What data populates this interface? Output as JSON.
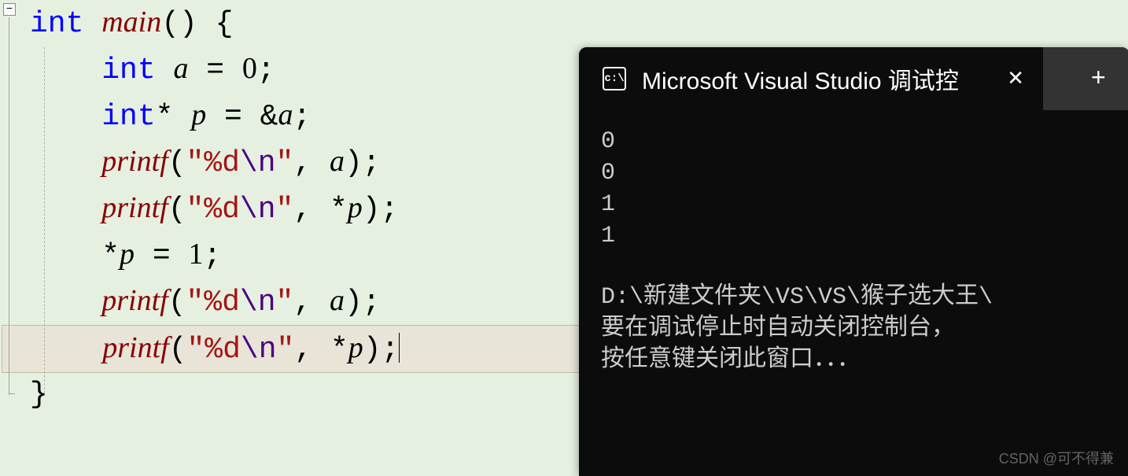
{
  "editor": {
    "fold_symbol": "−",
    "lines": [
      {
        "indent": 0,
        "tokens": [
          {
            "cls": "kw",
            "t": "int"
          },
          {
            "cls": "",
            "t": " "
          },
          {
            "cls": "fn ident",
            "t": "main"
          },
          {
            "cls": "op",
            "t": "() {"
          }
        ]
      },
      {
        "indent": 1,
        "tokens": [
          {
            "cls": "kw",
            "t": "int"
          },
          {
            "cls": "",
            "t": " "
          },
          {
            "cls": "ident",
            "t": "a"
          },
          {
            "cls": "op",
            "t": " = "
          },
          {
            "cls": "num",
            "t": "0"
          },
          {
            "cls": "op",
            "t": ";"
          }
        ]
      },
      {
        "indent": 1,
        "tokens": [
          {
            "cls": "kw",
            "t": "int"
          },
          {
            "cls": "op",
            "t": "* "
          },
          {
            "cls": "ident",
            "t": "p"
          },
          {
            "cls": "op",
            "t": " = &"
          },
          {
            "cls": "ident",
            "t": "a"
          },
          {
            "cls": "op",
            "t": ";"
          }
        ]
      },
      {
        "indent": 1,
        "tokens": [
          {
            "cls": "fn ident",
            "t": "printf"
          },
          {
            "cls": "op",
            "t": "("
          },
          {
            "cls": "str",
            "t": "\"%d"
          },
          {
            "cls": "esc",
            "t": "\\n"
          },
          {
            "cls": "str",
            "t": "\""
          },
          {
            "cls": "op",
            "t": ", "
          },
          {
            "cls": "ident",
            "t": "a"
          },
          {
            "cls": "op",
            "t": ");"
          }
        ]
      },
      {
        "indent": 1,
        "tokens": [
          {
            "cls": "fn ident",
            "t": "printf"
          },
          {
            "cls": "op",
            "t": "("
          },
          {
            "cls": "str",
            "t": "\"%d"
          },
          {
            "cls": "esc",
            "t": "\\n"
          },
          {
            "cls": "str",
            "t": "\""
          },
          {
            "cls": "op",
            "t": ", *"
          },
          {
            "cls": "ident",
            "t": "p"
          },
          {
            "cls": "op",
            "t": ");"
          }
        ]
      },
      {
        "indent": 1,
        "tokens": [
          {
            "cls": "op",
            "t": "*"
          },
          {
            "cls": "ident",
            "t": "p"
          },
          {
            "cls": "op",
            "t": " = "
          },
          {
            "cls": "num",
            "t": "1"
          },
          {
            "cls": "op",
            "t": ";"
          }
        ]
      },
      {
        "indent": 1,
        "tokens": [
          {
            "cls": "fn ident",
            "t": "printf"
          },
          {
            "cls": "op",
            "t": "("
          },
          {
            "cls": "str",
            "t": "\"%d"
          },
          {
            "cls": "esc",
            "t": "\\n"
          },
          {
            "cls": "str",
            "t": "\""
          },
          {
            "cls": "op",
            "t": ", "
          },
          {
            "cls": "ident",
            "t": "a"
          },
          {
            "cls": "op",
            "t": ");"
          }
        ]
      },
      {
        "indent": 1,
        "highlight": true,
        "cursor": true,
        "tokens": [
          {
            "cls": "fn ident",
            "t": "printf"
          },
          {
            "cls": "op",
            "t": "("
          },
          {
            "cls": "str",
            "t": "\"%d"
          },
          {
            "cls": "esc",
            "t": "\\n"
          },
          {
            "cls": "str",
            "t": "\""
          },
          {
            "cls": "op",
            "t": ", *"
          },
          {
            "cls": "ident",
            "t": "p"
          },
          {
            "cls": "op",
            "t": ");"
          }
        ]
      },
      {
        "indent": 0,
        "tokens": [
          {
            "cls": "op",
            "t": "}"
          }
        ]
      }
    ]
  },
  "console": {
    "tab_title": "Microsoft Visual Studio 调试控",
    "terminal_icon_text": "c:\\",
    "close_label": "✕",
    "new_tab_label": "+",
    "output_lines": [
      "0",
      "0",
      "1",
      "1"
    ],
    "path_line": "D:\\新建文件夹\\VS\\VS\\猴子选大王\\",
    "msg_line1": "要在调试停止时自动关闭控制台，",
    "msg_line2": "按任意键关闭此窗口．．．"
  },
  "watermark": "CSDN @可不得兼"
}
